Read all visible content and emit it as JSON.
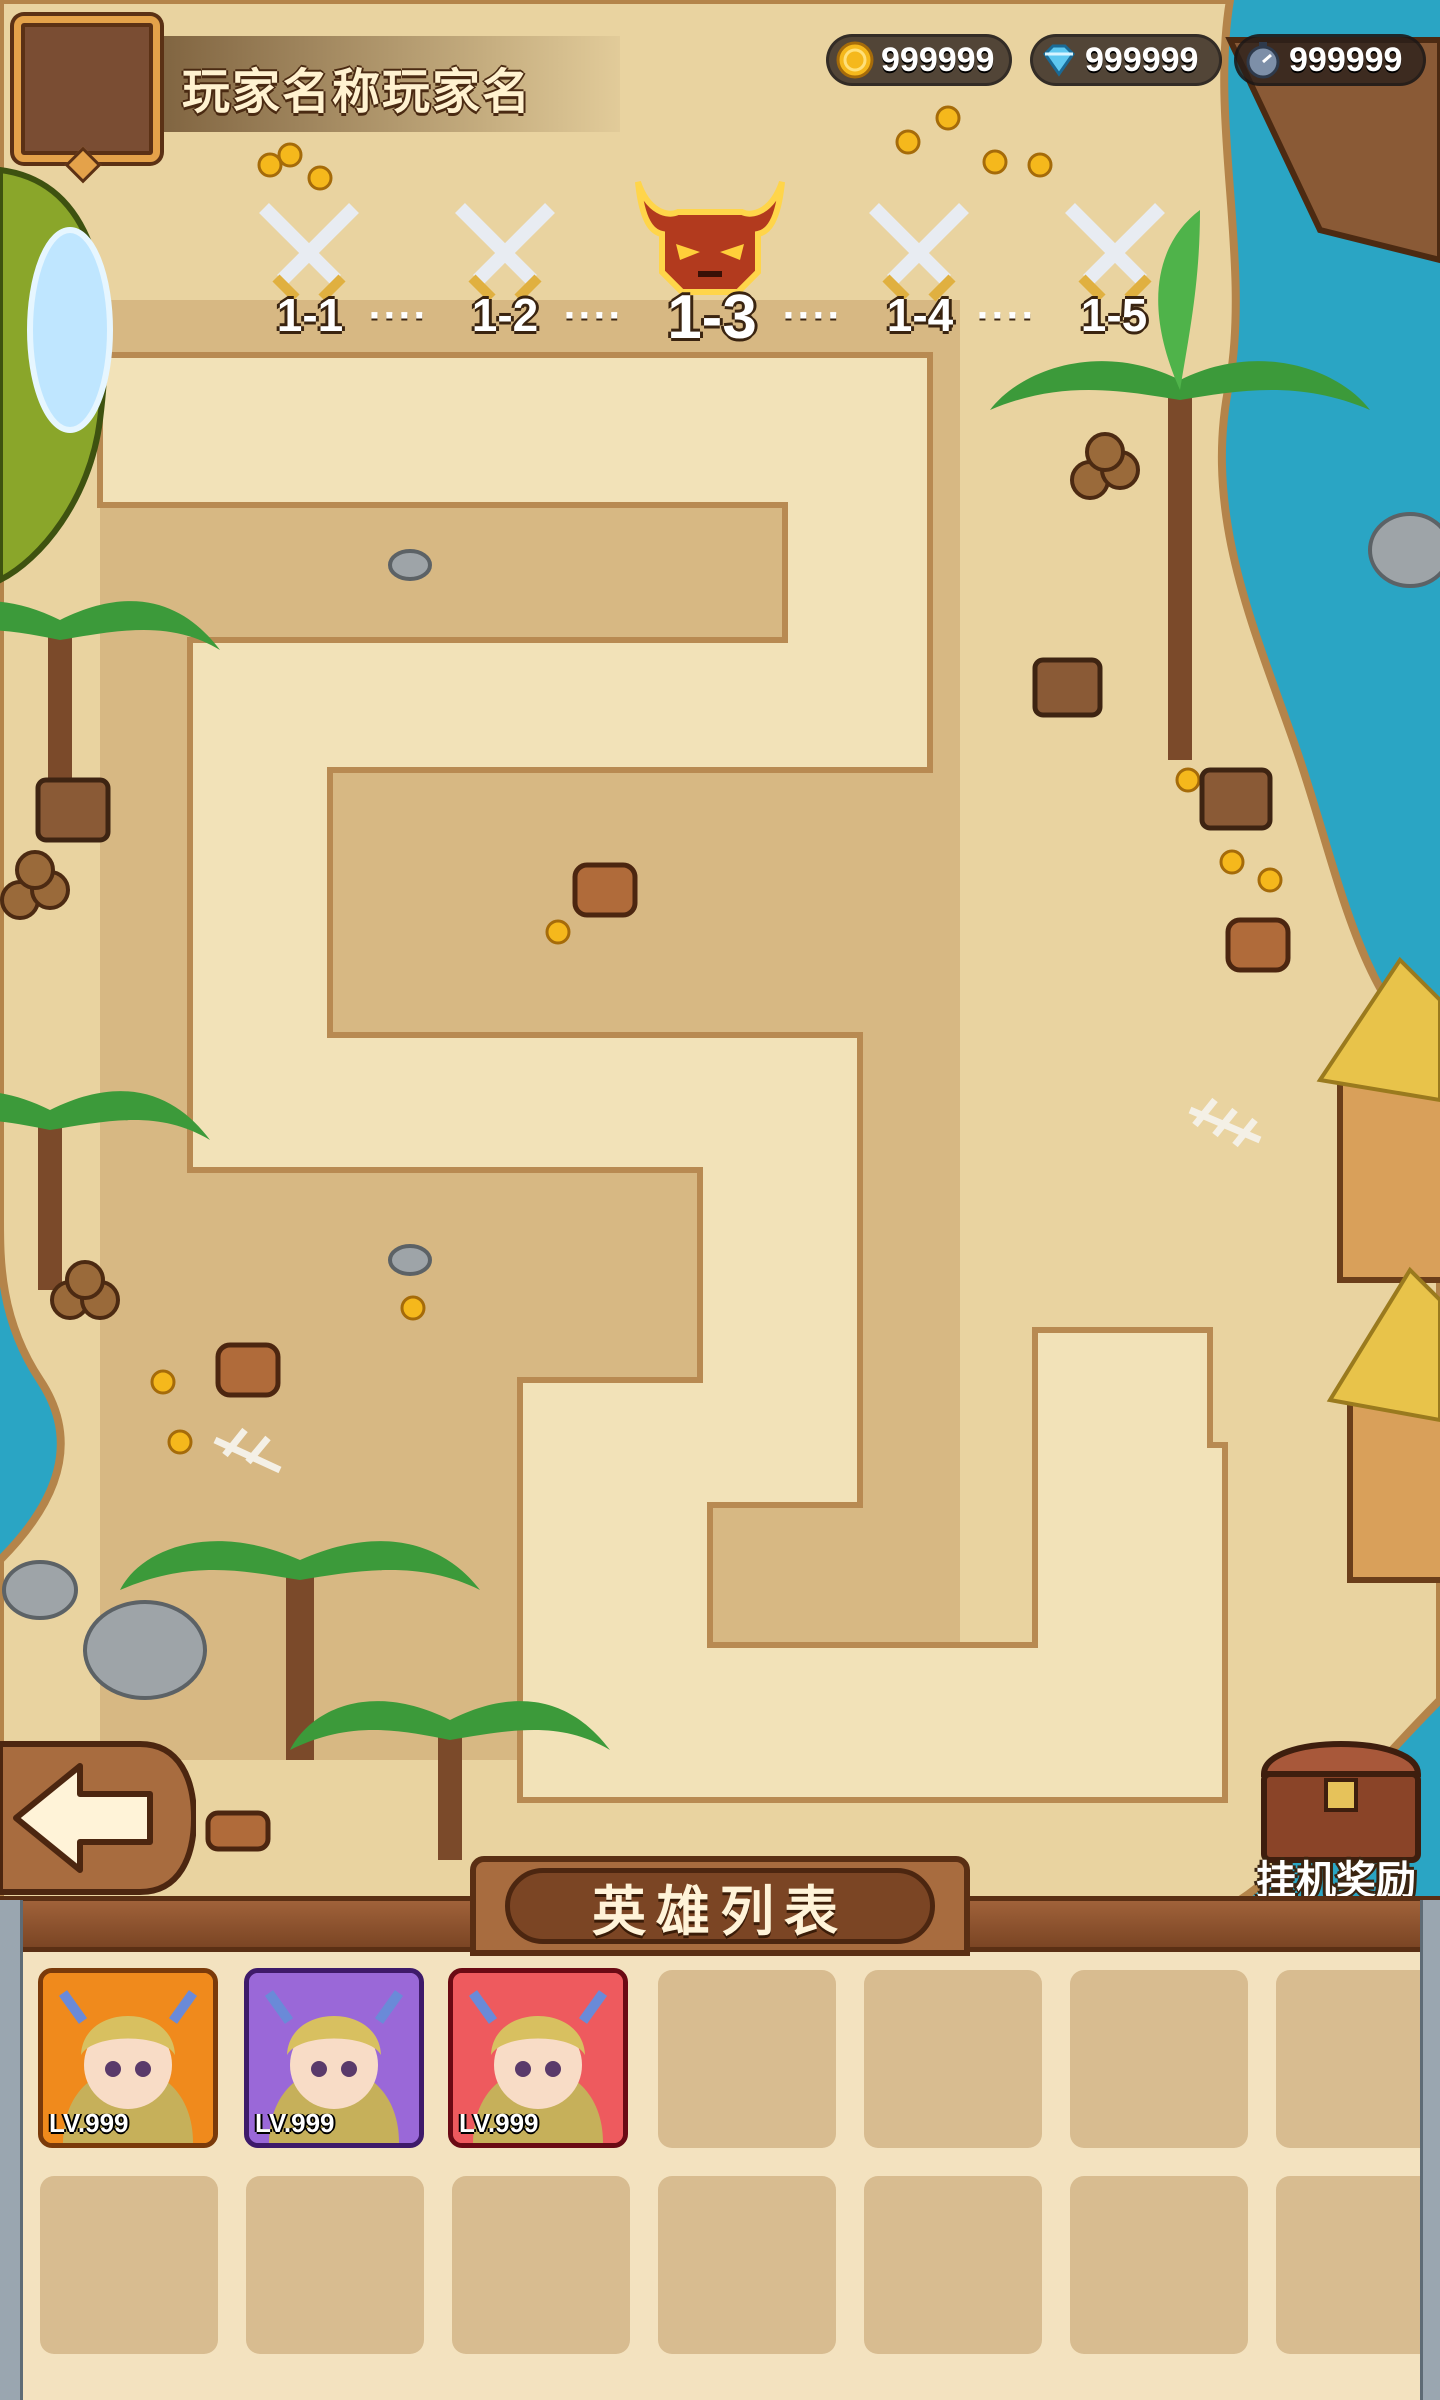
{
  "player": {
    "name": "玩家名称玩家名"
  },
  "currencies": [
    {
      "icon": "gold-coin-icon",
      "value": "999999",
      "color": "#f5b81c"
    },
    {
      "icon": "diamond-icon",
      "value": "999999",
      "color": "#5fc8f0"
    },
    {
      "icon": "stopwatch-icon",
      "value": "999999",
      "color": "#7d8fa8"
    }
  ],
  "stages": [
    {
      "label": "1-1",
      "icon": "crossed-swords-icon",
      "current": false
    },
    {
      "label": "1-2",
      "icon": "crossed-swords-icon",
      "current": false
    },
    {
      "label": "1-3",
      "icon": "demon-skull-icon",
      "current": true
    },
    {
      "label": "1-4",
      "icon": "crossed-swords-icon",
      "current": false
    },
    {
      "label": "1-5",
      "icon": "crossed-swords-icon",
      "current": false
    }
  ],
  "stage_separator": "····",
  "back_button": {
    "icon": "arrow-left-icon"
  },
  "idle_reward": {
    "label": "挂机奖励",
    "icon": "treasure-chest-icon"
  },
  "hero_panel": {
    "title": "英雄列表",
    "heroes": [
      {
        "level": "LV.999",
        "frame_color": "#f08a1c",
        "bg": "#f5a43a"
      },
      {
        "level": "LV.999",
        "frame_color": "#7a3fb8",
        "bg": "#9a68d8"
      },
      {
        "level": "LV.999",
        "frame_color": "#c8283a",
        "bg": "#ee5a5e"
      }
    ],
    "empty_slots": 11
  },
  "colors": {
    "sand": "#e9d3a0",
    "path_light": "#f2e2b8",
    "path_dark": "#c9a26b",
    "sea": "#2aa5c4",
    "panel_bg": "#f3e2bf",
    "wood": "#7b4524"
  }
}
